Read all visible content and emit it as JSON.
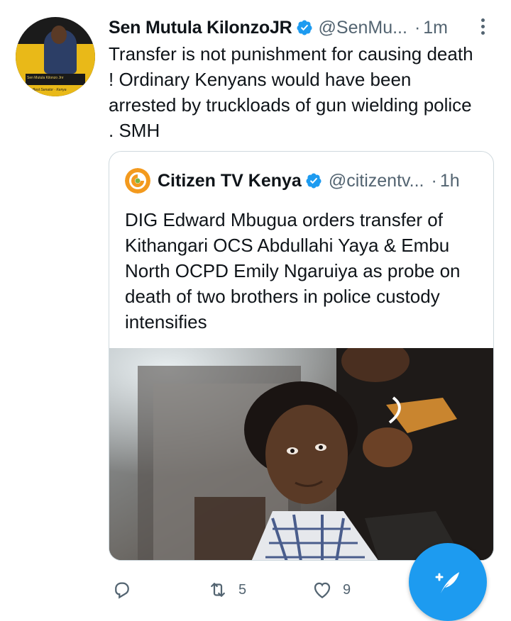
{
  "tweet": {
    "author": {
      "name": "Sen Mutula KilonzoJR",
      "handle": "@SenMu...",
      "time_separator": "·",
      "time": "1m",
      "verified": true,
      "avatar_text": {
        "plate": "Sen Mutula Kilonzo Jnr",
        "tagline": "Best Senator · Kenya"
      }
    },
    "text": "Transfer is not punishment for causing death ! Ordinary Kenyans would have been arrested by truckloads of gun wielding police . SMH",
    "quoted": {
      "author": {
        "name": "Citizen TV Kenya",
        "handle": "@citizentv...",
        "time_separator": "·",
        "time": "1h",
        "verified": true
      },
      "text": "DIG Edward Mbugua orders transfer of Kithangari OCS Abdullahi Yaya & Embu North OCPD Emily Ngaruiya as probe on death of two brothers in police custody intensifies",
      "image": {
        "description_icon": "photo-of-two-young-men"
      }
    },
    "actions": {
      "reply": {
        "icon": "reply-icon",
        "count": ""
      },
      "retweet": {
        "icon": "retweet-icon",
        "count": "5"
      },
      "like": {
        "icon": "heart-icon",
        "count": "9"
      }
    },
    "compose_icon": "compose-feather-icon"
  },
  "colors": {
    "accent": "#1d9bf0",
    "secondary_text": "#536471",
    "border": "#cfd9de",
    "primary_text": "#0f1419"
  }
}
